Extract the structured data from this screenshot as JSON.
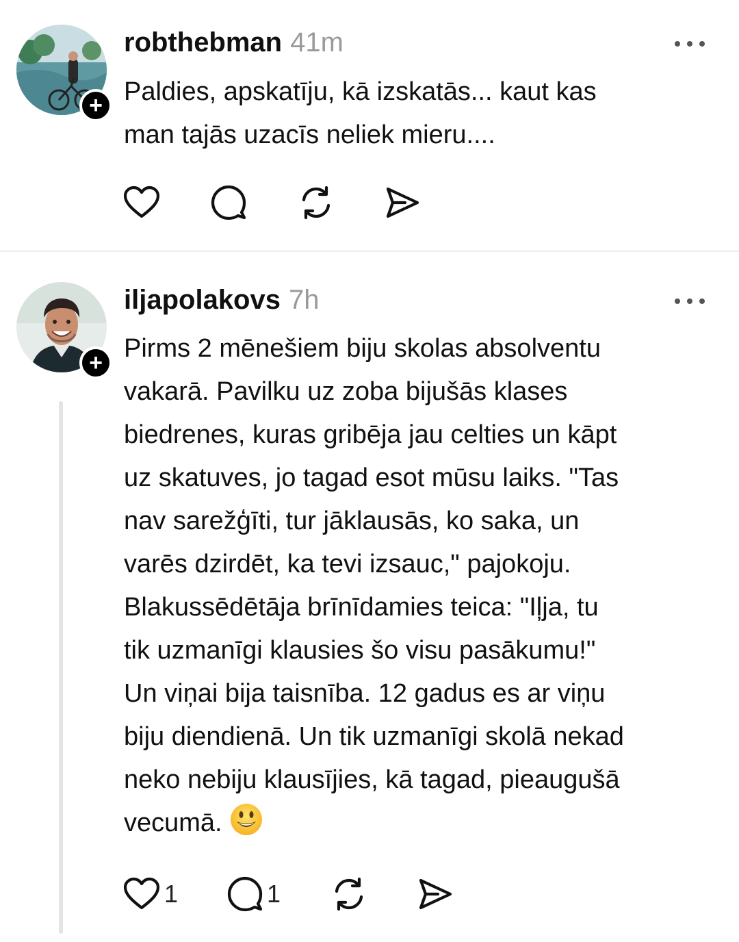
{
  "posts": [
    {
      "username": "robthebman",
      "time": "41m",
      "text": "Paldies, apskatīju, kā izskatās... kaut kas\nman tajās uzacīs neliek mieru....",
      "likes": "",
      "replies": ""
    },
    {
      "username": "iljapolakovs",
      "time": "7h",
      "text": "Pirms 2 mēnešiem biju skolas absolventu\nvakarā. Pavilku uz zoba bijušās klases\nbiedrenes, kuras gribēja jau celties un kāpt\nuz skatuves, jo tagad esot mūsu laiks. \"Tas\nnav sarežģīti, tur jāklausās, ko saka, un\nvarēs dzirdēt, ka tevi izsauc,\" pajokoju.\nBlakussēdētāja brīnīdamies teica: \"Iļja, tu\ntik uzmanīgi klausies šo visu pasākumu!\"\nUn viņai bija taisnība. 12 gadus es ar viņu\nbiju diendienā. Un tik uzmanīgi skolā nekad\nneko nebiju klausījies, kā tagad, pieaugušā\nvecumā.",
      "emoji": "smiling-face-emoji",
      "likes": "1",
      "replies": "1"
    }
  ],
  "icons": {
    "follow": "+",
    "like": "heart-icon",
    "reply": "comment-icon",
    "repost": "repost-icon",
    "share": "share-icon",
    "more": "more-icon"
  },
  "colors": {
    "text": "#111111",
    "muted": "#9a9a9a",
    "badge": "#000000",
    "divider": "#ececec",
    "thread": "#e4e4e4"
  }
}
